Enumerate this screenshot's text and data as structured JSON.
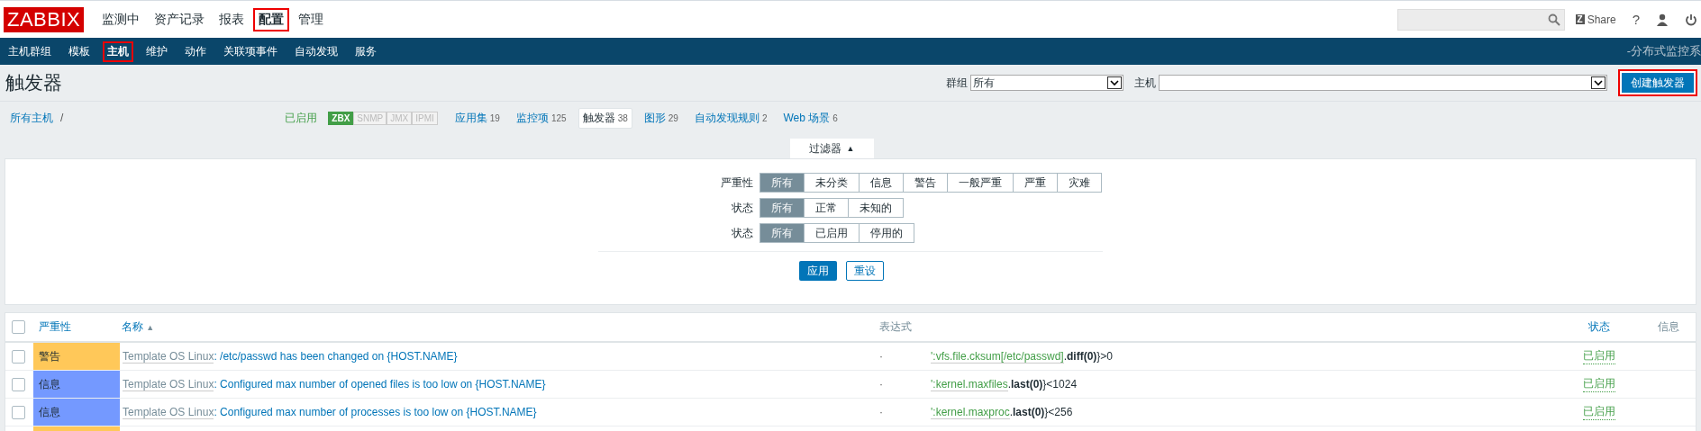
{
  "logo": "ZABBIX",
  "top_menu": [
    {
      "label": "监测中",
      "selected": false,
      "highlighted": false
    },
    {
      "label": "资产记录",
      "selected": false,
      "highlighted": false
    },
    {
      "label": "报表",
      "selected": false,
      "highlighted": false
    },
    {
      "label": "配置",
      "selected": true,
      "highlighted": true
    },
    {
      "label": "管理",
      "selected": false,
      "highlighted": false
    }
  ],
  "share_icon": "Z",
  "share": "Share",
  "help": "?",
  "sub_menu": [
    {
      "label": "主机群组",
      "selected": false,
      "highlighted": false
    },
    {
      "label": "模板",
      "selected": false,
      "highlighted": false
    },
    {
      "label": "主机",
      "selected": true,
      "highlighted": true
    },
    {
      "label": "维护",
      "selected": false,
      "highlighted": false
    },
    {
      "label": "动作",
      "selected": false,
      "highlighted": false
    },
    {
      "label": "关联项事件",
      "selected": false,
      "highlighted": false
    },
    {
      "label": "自动发现",
      "selected": false,
      "highlighted": false
    },
    {
      "label": "服务",
      "selected": false,
      "highlighted": false
    }
  ],
  "system_name": "-分布式监控系",
  "page_title": "触发器",
  "group_filter": {
    "label": "群组",
    "value": "所有"
  },
  "host_filter": {
    "label": "主机"
  },
  "create_button": {
    "label": "创建触发器",
    "highlighted": true
  },
  "breadcrumb": {
    "all_hosts": "所有主机",
    "separator": "/",
    "status": "已启用",
    "availability": [
      {
        "label": "ZBX",
        "on": true
      },
      {
        "label": "SNMP",
        "on": false
      },
      {
        "label": "JMX",
        "on": false
      },
      {
        "label": "IPMI",
        "on": false
      }
    ],
    "tabs": [
      {
        "label": "应用集",
        "count": "19",
        "selected": false
      },
      {
        "label": "监控项",
        "count": "125",
        "selected": false
      },
      {
        "label": "触发器",
        "count": "38",
        "selected": true
      },
      {
        "label": "图形",
        "count": "29",
        "selected": false
      },
      {
        "label": "自动发现规则",
        "count": "2",
        "selected": false
      },
      {
        "label": "Web 场景",
        "count": "6",
        "selected": false
      }
    ]
  },
  "filter": {
    "toggle": "过滤器",
    "arrow": "▲",
    "groups": [
      {
        "label": "严重性",
        "options": [
          {
            "label": "所有",
            "selected": true
          },
          {
            "label": "未分类",
            "selected": false
          },
          {
            "label": "信息",
            "selected": false
          },
          {
            "label": "警告",
            "selected": false
          },
          {
            "label": "一般严重",
            "selected": false
          },
          {
            "label": "严重",
            "selected": false
          },
          {
            "label": "灾难",
            "selected": false
          }
        ]
      },
      {
        "label": "状态",
        "options": [
          {
            "label": "所有",
            "selected": true
          },
          {
            "label": "正常",
            "selected": false
          },
          {
            "label": "未知的",
            "selected": false
          }
        ]
      },
      {
        "label": "状态",
        "options": [
          {
            "label": "所有",
            "selected": true
          },
          {
            "label": "已启用",
            "selected": false
          },
          {
            "label": "停用的",
            "selected": false
          }
        ]
      }
    ],
    "apply": "应用",
    "reset": "重设"
  },
  "table": {
    "select_all": {
      "checked": false
    },
    "columns": [
      {
        "label": "严重性",
        "kind": "link"
      },
      {
        "label": "名称",
        "kind": "sorted",
        "arrow": "▲"
      },
      {
        "label": "表达式",
        "kind": "plain"
      },
      {
        "label": "状态",
        "kind": "link"
      },
      {
        "label": "信息",
        "kind": "plain"
      }
    ],
    "rows": [
      {
        "kind": "full",
        "checked": false,
        "severity": "警告",
        "color": "#ffc859",
        "template": "Template OS Linux",
        "sep": ":",
        "name": "/etc/passwd has been changed on {HOST.NAME}",
        "expr_dot": "·",
        "expr_item": "':vfs.file.cksum[/etc/passwd]",
        "expr_func": ".**diff(0)**}>0",
        "status": "已启用"
      },
      {
        "kind": "full",
        "checked": false,
        "severity": "信息",
        "color": "#7499ff",
        "template": "Template OS Linux",
        "sep": ":",
        "name": "Configured max number of opened files is too low on {HOST.NAME}",
        "expr_dot": "·",
        "expr_item": "':kernel.maxfiles",
        "expr_func": ".**last(0)**}<1024",
        "status": "已启用"
      },
      {
        "kind": "full",
        "checked": false,
        "severity": "信息",
        "color": "#7499ff",
        "template": "Template OS Linux",
        "sep": ":",
        "name": "Configured max number of processes is too low on {HOST.NAME}",
        "expr_dot": "·",
        "expr_item": "':kernel.maxproc",
        "expr_func": ".**last(0)**}<256",
        "status": "已启用"
      },
      {
        "kind": "partial",
        "color": "#ffc859"
      }
    ]
  }
}
